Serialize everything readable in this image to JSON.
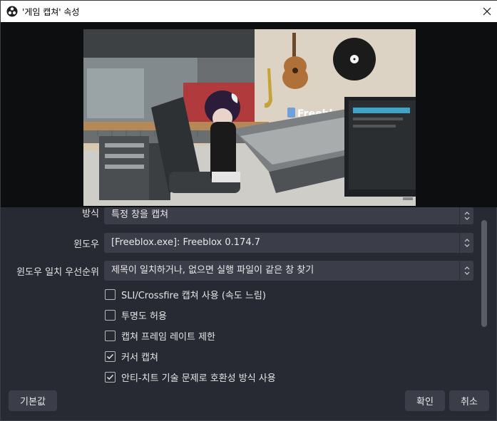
{
  "window": {
    "title": "'게임 캡쳐' 속성"
  },
  "preview": {
    "brand_text": "Freeblox"
  },
  "form": {
    "mode": {
      "label": "방식",
      "value": "특정 창을 캡쳐"
    },
    "window": {
      "label": "윈도우",
      "value": "[Freeblox.exe]: Freeblox 0.174.7"
    },
    "priority": {
      "label": "윈도우 일치 우선순위",
      "value": "제목이 일치하거나, 없으면 실행 파일이 같은 창 찾기"
    },
    "checkboxes": [
      {
        "label": "SLI/Crossfire 캡쳐 사용 (속도 느림)",
        "checked": false
      },
      {
        "label": "투명도 허용",
        "checked": false
      },
      {
        "label": "캡쳐 프레임 레이트 제한",
        "checked": false
      },
      {
        "label": "커서 캡쳐",
        "checked": true
      },
      {
        "label": "안티-치트 기술 문제로 호환성 방식 사용",
        "checked": true
      }
    ]
  },
  "buttons": {
    "defaults": "기본값",
    "ok": "확인",
    "cancel": "취소"
  },
  "icons": {
    "app": "obs-logo-icon",
    "close": "close-icon",
    "spin": "updown-chevron-icon",
    "check": "checkmark-icon"
  },
  "colors": {
    "background": "#272a33",
    "control": "#3b3e48",
    "text": "#e6e6e6"
  }
}
